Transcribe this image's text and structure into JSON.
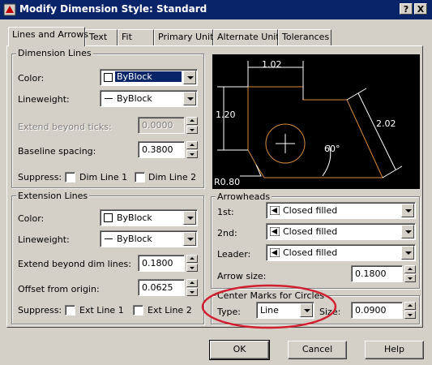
{
  "window": {
    "title": "Modify Dimension Style: Standard",
    "help_button": "?",
    "close_button": "X"
  },
  "tabs": [
    {
      "label": "Lines and Arrows"
    },
    {
      "label": "Text"
    },
    {
      "label": "Fit"
    },
    {
      "label": "Primary Units"
    },
    {
      "label": "Alternate Units"
    },
    {
      "label": "Tolerances"
    }
  ],
  "dimension_lines": {
    "title": "Dimension Lines",
    "color_label": "Color:",
    "color_value": "ByBlock",
    "lineweight_label": "Lineweight:",
    "lineweight_value": "ByBlock",
    "extend_label": "Extend beyond ticks:",
    "extend_value": "0.0000",
    "baseline_label": "Baseline spacing:",
    "baseline_value": "0.3800",
    "suppress_label": "Suppress:",
    "dimline1_label": "Dim Line 1",
    "dimline2_label": "Dim Line 2"
  },
  "extension_lines": {
    "title": "Extension Lines",
    "color_label": "Color:",
    "color_value": "ByBlock",
    "lineweight_label": "Lineweight:",
    "lineweight_value": "ByBlock",
    "extend_label": "Extend beyond dim lines:",
    "extend_value": "0.1800",
    "offset_label": "Offset from origin:",
    "offset_value": "0.0625",
    "suppress_label": "Suppress:",
    "extline1_label": "Ext Line 1",
    "extline2_label": "Ext Line 2"
  },
  "preview": {
    "dim_top": "1.02",
    "dim_left": "1.20",
    "dim_right": "2.02",
    "dim_angle": "60°",
    "dim_radius": "R0.80"
  },
  "arrowheads": {
    "title": "Arrowheads",
    "first_label": "1st:",
    "first_value": "Closed filled",
    "second_label": "2nd:",
    "second_value": "Closed filled",
    "leader_label": "Leader:",
    "leader_value": "Closed filled",
    "size_label": "Arrow size:",
    "size_value": "0.1800"
  },
  "center_marks": {
    "title": "Center Marks for Circles",
    "type_label": "Type:",
    "type_value": "Line",
    "size_label": "Size:",
    "size_value": "0.0900"
  },
  "buttons": {
    "ok": "OK",
    "cancel": "Cancel",
    "help": "Help"
  },
  "colors": {
    "titlebar": "#0a246a",
    "dialog": "#d4d0c8",
    "preview_bg": "#000000",
    "preview_shape": "#d88a3a",
    "highlight_ellipse": "#d02030"
  }
}
